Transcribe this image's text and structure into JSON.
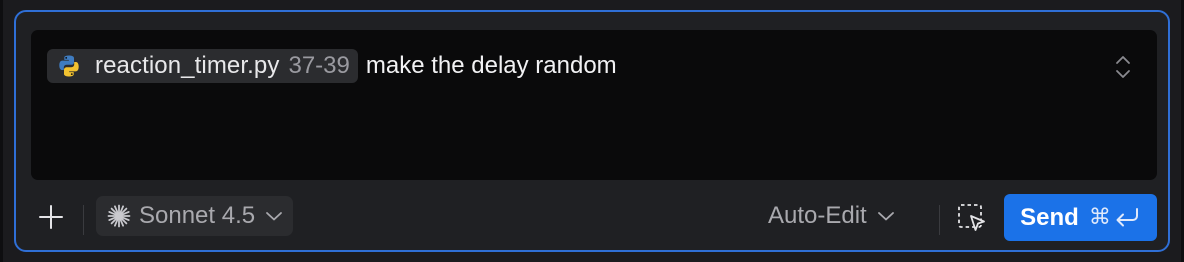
{
  "composer": {
    "context_chip": {
      "icon": "python-icon",
      "file_name": "reaction_timer.py",
      "line_range": "37-39"
    },
    "prompt_text": "make the delay random",
    "expand_icon": "chevron-up-down-icon"
  },
  "toolbar": {
    "add_icon": "plus-icon",
    "model": {
      "icon": "sparkle-icon",
      "label": "Sonnet 4.5"
    },
    "mode": {
      "label": "Auto-Edit"
    },
    "select_tool_icon": "selection-cursor-icon",
    "send": {
      "label": "Send",
      "shortcut_cmd": "⌘",
      "shortcut_icon": "return-icon"
    }
  },
  "colors": {
    "accent": "#1b72e8",
    "focus_border": "#2f6fd6",
    "input_background": "#0a0a0b"
  }
}
